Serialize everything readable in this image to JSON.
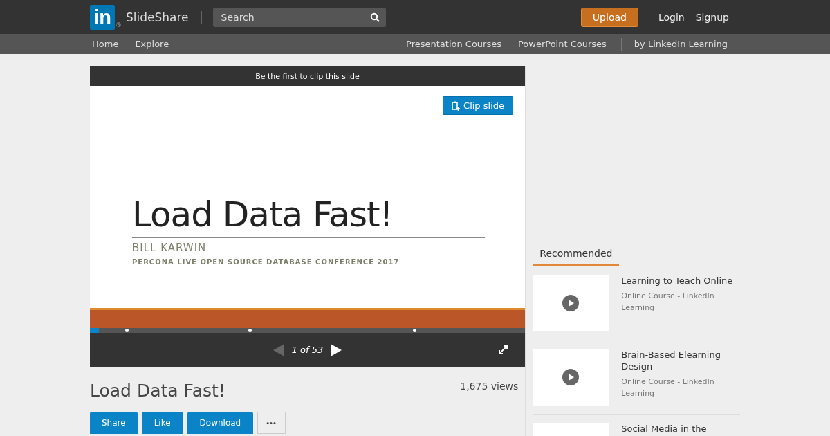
{
  "header": {
    "logo": "in",
    "logo_mark": "®",
    "brand": "SlideShare",
    "search": {
      "placeholder": "Search"
    },
    "upload": "Upload",
    "links": [
      "Login",
      "Signup"
    ]
  },
  "subnav": {
    "left": [
      "Home",
      "Explore"
    ],
    "right": [
      "Presentation Courses",
      "PowerPoint Courses"
    ],
    "extra": "by LinkedIn Learning"
  },
  "player": {
    "clip_banner": "Be the first to clip this slide",
    "clip_button": "Clip slide",
    "slide": {
      "title": "Load Data Fast!",
      "author": "BILL KARWIN",
      "event": "PERCONA LIVE OPEN SOURCE DATABASE CONFERENCE 2017"
    },
    "progress": {
      "level": 0.02
    },
    "page": "1 of 53",
    "prev_disabled": true
  },
  "title": "Load Data Fast!",
  "views": "1,675 views",
  "actions": [
    "Share",
    "Like",
    "Download"
  ],
  "more": "•••",
  "recommended": {
    "tab": "Recommended",
    "items": [
      {
        "title": "Learning to Teach Online",
        "subtitle": "Online Course - LinkedIn Learning"
      },
      {
        "title": "Brain-Based Elearning Design",
        "subtitle": "Online Course - LinkedIn Learning"
      },
      {
        "title": "Social Media in the"
      }
    ]
  }
}
